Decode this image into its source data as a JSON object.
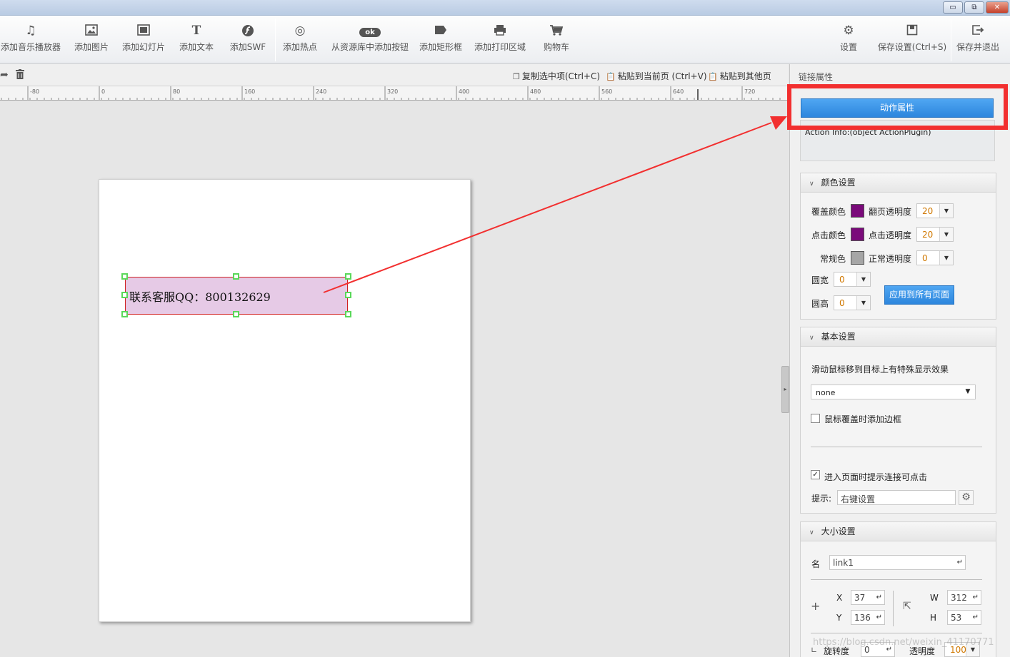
{
  "window": {
    "btn_min": "▭",
    "btn_max": "⧉",
    "btn_close": "✕"
  },
  "toolbar": {
    "music": "添加音乐播放器",
    "image": "添加图片",
    "slideshow": "添加幻灯片",
    "text": "添加文本",
    "swf": "添加SWF",
    "hotspot": "添加热点",
    "resource_button": "从资源库中添加按钮",
    "ok_badge": "ok",
    "rect_frame": "添加矩形框",
    "print_area": "添加打印区域",
    "cart": "购物车",
    "settings": "设置",
    "save_settings": "保存设置(Ctrl+S)",
    "save_exit": "保存并退出",
    "text_glyph": "T"
  },
  "subbar": {
    "copy": "复制选中项(Ctrl+C)",
    "paste_current": "粘贴到当前页 (Ctrl+V)",
    "paste_other": "粘贴到其他页"
  },
  "ruler": {
    "ticks": [
      "-80",
      "0",
      "80",
      "160",
      "240",
      "320",
      "400",
      "480",
      "560",
      "640",
      "720"
    ]
  },
  "canvas": {
    "hotspot_text": "联系客服QQ：800132629"
  },
  "panel": {
    "title": "链接属性",
    "action_button": "动作属性",
    "action_info": "Action Info:(object ActionPlugin)",
    "color_section": {
      "title": "颜色设置",
      "cover_color_label": "覆盖颜色",
      "cover_color": "#7a0a7a",
      "flip_opacity_label": "翻页透明度",
      "flip_opacity": "20",
      "click_color_label": "点击颜色",
      "click_color": "#7a0a7a",
      "click_opacity_label": "点击透明度",
      "click_opacity": "20",
      "normal_color_label": "常规色",
      "normal_color": "#a6a6a6",
      "normal_opacity_label": "正常透明度",
      "normal_opacity": "0",
      "round_w_label": "圆宽",
      "round_w": "0",
      "round_h_label": "圆高",
      "round_h": "0",
      "apply_all": "应用到所有页面"
    },
    "basic_section": {
      "title": "基本设置",
      "hover_label": "滑动鼠标移到目标上有特殊显示效果",
      "hover_effect": "none",
      "border_on_hover": "鼠标覆盖时添加边框",
      "border_on_hover_checked": false,
      "hint_on_enter": "进入页面时提示连接可点击",
      "hint_on_enter_checked": true,
      "hint_label": "提示:",
      "hint_value": "右键设置"
    },
    "size_section": {
      "title": "大小设置",
      "name_label": "名",
      "name_value": "link1",
      "x_label": "X",
      "x": "37",
      "y_label": "Y",
      "y": "136",
      "w_label": "W",
      "w": "312",
      "h_label": "H",
      "h": "53",
      "rotation_label": "旋转度",
      "rotation": "0",
      "opacity_label": "透明度",
      "opacity": "100"
    }
  },
  "watermark": "https://blog.csdn.net/weixin_41170771",
  "colors": {
    "accent": "#2d86dd",
    "highlight": "#f22f2f",
    "hotspot_fill": "#e6cae6"
  }
}
